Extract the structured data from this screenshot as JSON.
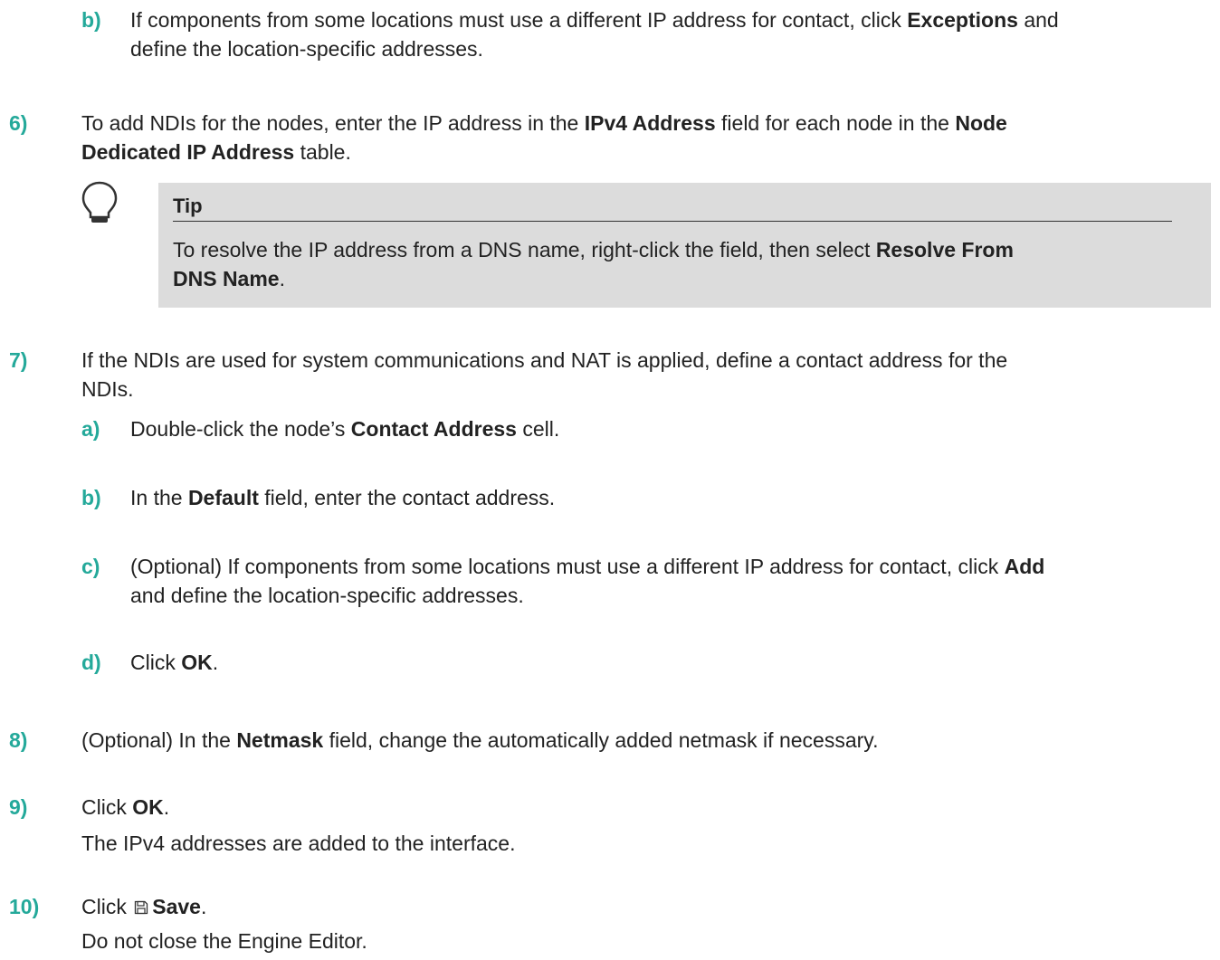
{
  "steps": {
    "s5b": {
      "num": "b)",
      "t1": "If components from some locations must use a different IP address for contact, click ",
      "b1": "Exceptions",
      "t2": " and",
      "t3": "define the location-specific addresses."
    },
    "s6": {
      "num": "6)",
      "t1": "To add NDIs for the nodes, enter the IP address in the ",
      "b1": "IPv4 Address",
      "t2": " field for each node in the ",
      "b2": "Node",
      "b3": "Dedicated IP Address",
      "t3": " table."
    },
    "tip": {
      "title": "Tip",
      "t1": "To resolve the IP address from a DNS name, right-click the field, then select ",
      "b1": "Resolve From",
      "b2": "DNS Name",
      "t2": "."
    },
    "s7": {
      "num": "7)",
      "t1": "If the NDIs are used for system communications and NAT is applied, define a contact address for the",
      "t2": "NDIs."
    },
    "s7a": {
      "num": "a)",
      "t1": "Double-click the node’s ",
      "b1": "Contact Address",
      "t2": " cell."
    },
    "s7b": {
      "num": "b)",
      "t1": "In the ",
      "b1": "Default",
      "t2": " field, enter the contact address."
    },
    "s7c": {
      "num": "c)",
      "t1": "(Optional) If components from some locations must use a different IP address for contact, click ",
      "b1": "Add",
      "t2": "and define the location-specific addresses."
    },
    "s7d": {
      "num": "d)",
      "t1": "Click ",
      "b1": "OK",
      "t2": "."
    },
    "s8": {
      "num": "8)",
      "t1": "(Optional) In the ",
      "b1": "Netmask",
      "t2": " field, change the automatically added netmask if necessary."
    },
    "s9": {
      "num": "9)",
      "t1": "Click ",
      "b1": "OK",
      "t2": ".",
      "result": "The IPv4 addresses are added to the interface."
    },
    "s10": {
      "num": "10)",
      "t1": "Click ",
      "icon": "save-icon",
      "b1": "Save",
      "t2": ".",
      "result": "Do not close the Engine Editor."
    }
  },
  "colors": {
    "step_number": "#24a99a",
    "tip_background": "#dcdcdc",
    "text": "#222222"
  }
}
